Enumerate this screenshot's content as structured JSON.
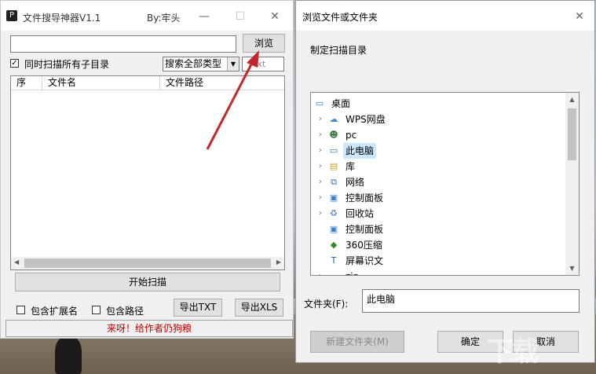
{
  "app": {
    "title": "文件搜导神器V1.1",
    "author": "By:牢头",
    "minimize": "—",
    "maximize": "☐",
    "close": "✕",
    "path_value": "",
    "browse_label": "浏览",
    "include_subdirs_label": "同时扫描所有子目录",
    "include_subdirs_checked": "✓",
    "type_select_value": "搜索全部类型",
    "ext_placeholder": "txt",
    "columns": [
      "序",
      "文件名",
      "文件路径"
    ],
    "start_scan_label": "开始扫描",
    "include_ext_label": "包含扩展名",
    "include_path_label": "包含路径",
    "export_txt_label": "导出TXT",
    "export_xls_label": "导出XLS",
    "status_text": "来呀！给作者仍狗粮"
  },
  "dialog": {
    "title": "浏览文件或文件夹",
    "close": "✕",
    "description": "制定扫描目录",
    "tree": [
      {
        "label": "桌面",
        "icon": "desktop-icon",
        "glyph": "▭",
        "expand": ""
      },
      {
        "label": "WPS网盘",
        "icon": "cloud-icon",
        "glyph": "☁",
        "expand": "›"
      },
      {
        "label": "pc",
        "icon": "user-icon",
        "glyph": "☻",
        "expand": "›"
      },
      {
        "label": "此电脑",
        "icon": "computer-icon",
        "glyph": "▭",
        "expand": "›",
        "selected": true
      },
      {
        "label": "库",
        "icon": "library-icon",
        "glyph": "▤",
        "expand": "›"
      },
      {
        "label": "网络",
        "icon": "network-icon",
        "glyph": "⧉",
        "expand": "›"
      },
      {
        "label": "控制面板",
        "icon": "control-panel-icon",
        "glyph": "▣",
        "expand": "›"
      },
      {
        "label": "回收站",
        "icon": "recycle-bin-icon",
        "glyph": "♻",
        "expand": "›"
      },
      {
        "label": "控制面板",
        "icon": "control-panel-icon",
        "glyph": "▣",
        "expand": ""
      },
      {
        "label": "360压缩",
        "icon": "zip-app-icon",
        "glyph": "◆",
        "expand": ""
      },
      {
        "label": "屏幕识文",
        "icon": "ocr-app-icon",
        "glyph": "T",
        "expand": ""
      },
      {
        "label": "zip",
        "icon": "folder-icon",
        "glyph": "▬",
        "expand": "›"
      }
    ],
    "folder_label": "文件夹(F):",
    "folder_value": "此电脑",
    "new_folder_label": "新建文件夹(M)",
    "ok_label": "确定",
    "cancel_label": "取消"
  },
  "colors": {
    "annotation_arrow": "#c0282c",
    "status_text": "#c00000",
    "selection": "#cce8ff"
  }
}
